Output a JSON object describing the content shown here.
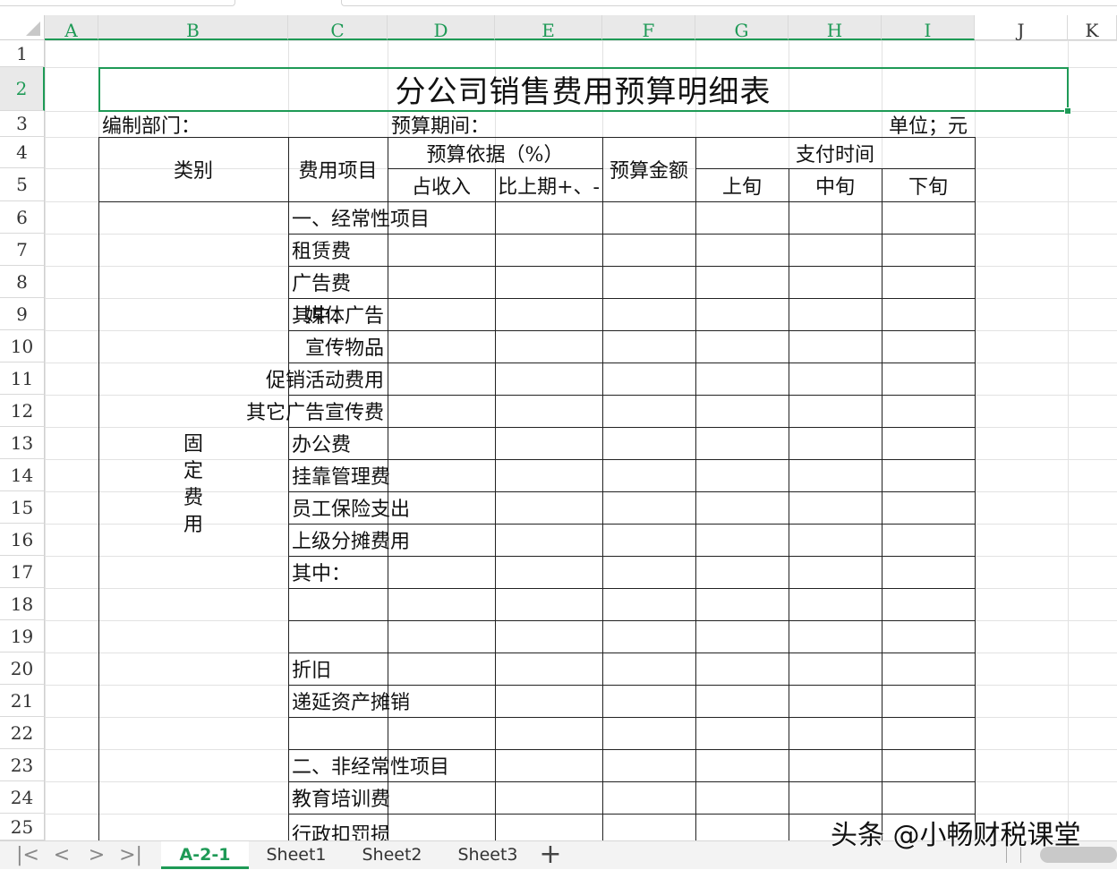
{
  "columns": [
    "A",
    "B",
    "C",
    "D",
    "E",
    "F",
    "G",
    "H",
    "I",
    "J",
    "K"
  ],
  "rows": [
    "1",
    "2",
    "3",
    "4",
    "5",
    "6",
    "7",
    "8",
    "9",
    "10",
    "11",
    "12",
    "13",
    "14",
    "15",
    "16",
    "17",
    "18",
    "19",
    "20",
    "21",
    "22",
    "23",
    "24",
    "25"
  ],
  "sheet": {
    "title": "分公司销售费用预算明细表",
    "dept_label": "编制部门：",
    "period_label": "预算期间：",
    "unit_label": "单位；元",
    "hdr_category": "类别",
    "hdr_item": "费用项目",
    "hdr_basis": "预算依据（%）",
    "hdr_basis_income": "占收入",
    "hdr_basis_prev": "比上期+、-",
    "hdr_amount": "预算金额",
    "hdr_paytime": "支付时间",
    "hdr_early": "上旬",
    "hdr_mid": "中旬",
    "hdr_late": "下旬",
    "category_fixed": "固定费用",
    "items": [
      "一、经常性项目",
      "租赁费",
      "广告费",
      "其中：",
      "媒体广告",
      "宣传物品",
      "促销活动费用",
      "其它广告宣传费",
      "办公费",
      "挂靠管理费",
      "员工保险支出",
      "上级分摊费用",
      "其中：",
      "折旧",
      "递延资产摊销",
      "二、非经常性项目",
      "教育培训费",
      "行政扣罚损失"
    ]
  },
  "sheet_tabs": [
    "A-2-1",
    "Sheet1",
    "Sheet2",
    "Sheet3"
  ],
  "active_tab": "A-2-1",
  "nav": {
    "first": "|<",
    "prev": "<",
    "next": ">",
    "last": ">|",
    "add": "+"
  },
  "watermark": "头条 @小畅财税课堂",
  "colors": {
    "accent": "#1e9a56",
    "gridline": "#e2e2e2",
    "border": "#222222"
  }
}
